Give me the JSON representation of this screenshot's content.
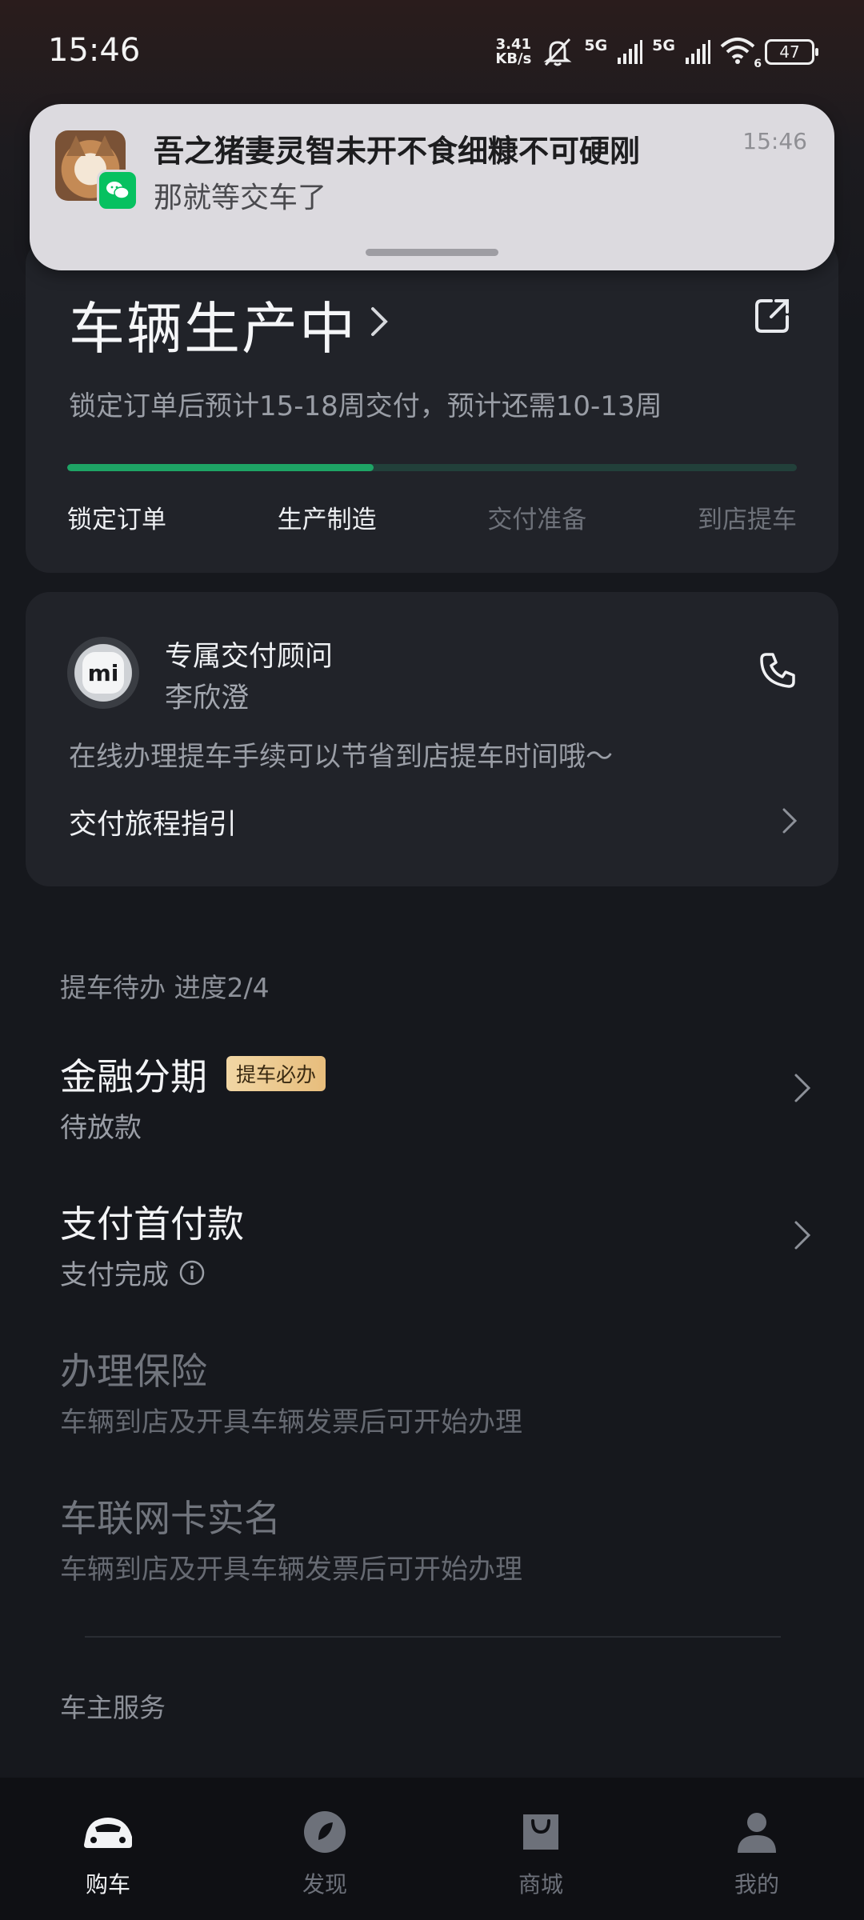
{
  "status_bar": {
    "time": "15:46",
    "net_speed_value": "3.41",
    "net_speed_unit": "KB/s",
    "sim1": "5G",
    "sim2": "5G",
    "wifi_sub": "6",
    "battery": "47"
  },
  "notification": {
    "title": "吾之猪妻灵智未开不食细糠不可硬刚",
    "message": "那就等交车了",
    "time": "15:46"
  },
  "order": {
    "status_title": "车辆生产中",
    "eta": "锁定订单后预计15-18周交付，预计还需10-13周",
    "progress": 0.42,
    "steps": [
      {
        "label": "锁定订单",
        "done": true
      },
      {
        "label": "生产制造",
        "done": true
      },
      {
        "label": "交付准备",
        "done": false
      },
      {
        "label": "到店提车",
        "done": false
      }
    ]
  },
  "advisor": {
    "role": "专属交付顾问",
    "name": "李欣澄",
    "tip": "在线办理提车手续可以节省到店提车时间哦～",
    "guide": "交付旅程指引",
    "logo_text": "mi"
  },
  "todo": {
    "header": "提车待办 进度2/4",
    "items": [
      {
        "title": "金融分期",
        "badge": "提车必办",
        "status": "待放款"
      },
      {
        "title": "支付首付款",
        "status": "支付完成"
      },
      {
        "title": "办理保险",
        "status": "车辆到店及开具车辆发票后可开始办理"
      },
      {
        "title": "车联网卡实名",
        "status": "车辆到店及开具车辆发票后可开始办理"
      }
    ]
  },
  "owner_services": {
    "header": "车主服务"
  },
  "bottom_nav": [
    {
      "label": "购车",
      "active": true
    },
    {
      "label": "发现",
      "active": false
    },
    {
      "label": "商城",
      "active": false
    },
    {
      "label": "我的",
      "active": false
    }
  ],
  "colors": {
    "accent_green": "#1ea465",
    "badge_gold": "#e7bd7c",
    "background": "#16181d",
    "card": "#212329"
  }
}
